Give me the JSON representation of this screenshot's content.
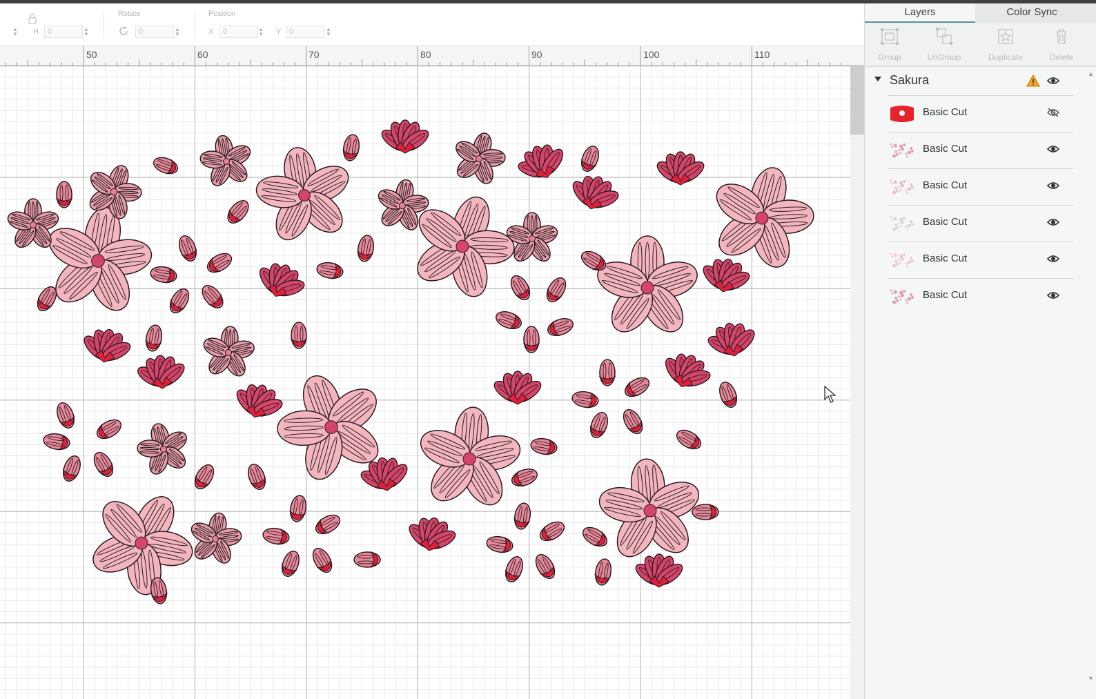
{
  "toolbar": {
    "h_label": "H",
    "h_value": "0",
    "rotate_label": "Rotate",
    "rotate_value": "0",
    "position_label": "Position",
    "x_label": "X",
    "x_value": "0",
    "y_label": "Y",
    "y_value": "0"
  },
  "ruler": {
    "labels": [
      "50",
      "60",
      "70",
      "80",
      "90",
      "100",
      "110"
    ]
  },
  "panel": {
    "tabs": [
      {
        "label": "Layers"
      },
      {
        "label": "Color Sync"
      }
    ],
    "tools": [
      {
        "label": "Group",
        "icon": "group-icon"
      },
      {
        "label": "UnGroup",
        "icon": "ungroup-icon"
      },
      {
        "label": "Duplicate",
        "icon": "duplicate-icon"
      },
      {
        "label": "Delete",
        "icon": "trash-icon"
      }
    ],
    "group": {
      "name": "Sakura"
    },
    "layers": [
      {
        "name": "Basic Cut",
        "visible": false,
        "thumb_color": "#e8222a"
      },
      {
        "name": "Basic Cut",
        "visible": true,
        "thumb_color": "#e3a3b0"
      },
      {
        "name": "Basic Cut",
        "visible": true,
        "thumb_color": "#e9c0c8"
      },
      {
        "name": "Basic Cut",
        "visible": true,
        "thumb_color": "#d8d8d8"
      },
      {
        "name": "Basic Cut",
        "visible": true,
        "thumb_color": "#f0c8d0"
      },
      {
        "name": "Basic Cut",
        "visible": true,
        "thumb_color": "#dfa0ae"
      }
    ]
  },
  "colors": {
    "petal_light": "#f3b6bf",
    "petal_dark": "#d5456a",
    "bud_red": "#e01f3a",
    "outline": "#2a1a1e",
    "accent_tab": "#5b8fa6"
  }
}
